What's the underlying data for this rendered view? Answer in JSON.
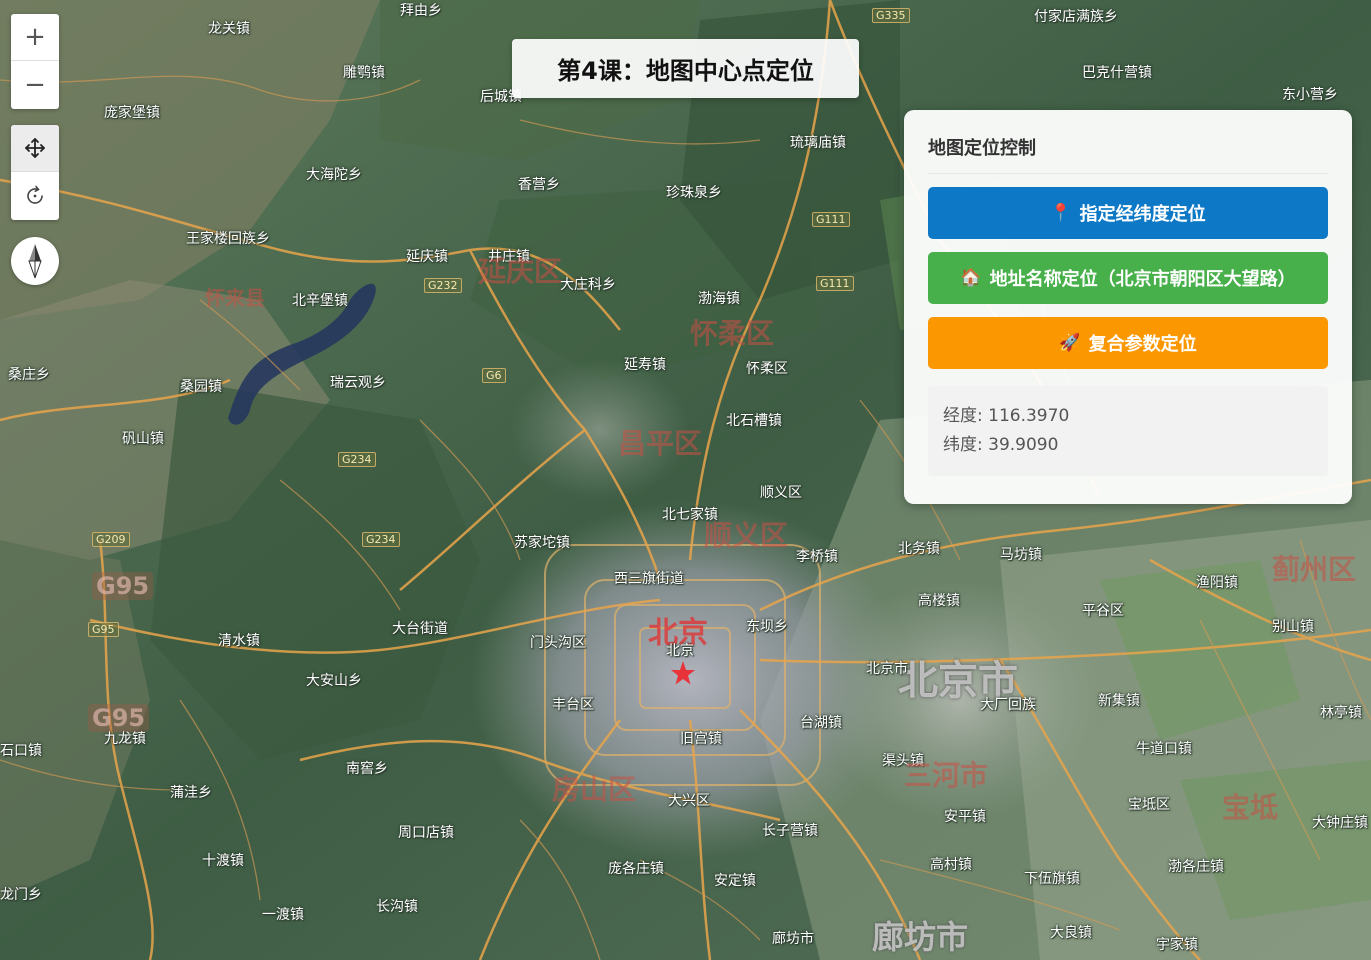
{
  "page_title": "第4课：地图中心点定位",
  "controls": {
    "zoom_in": "+",
    "zoom_out": "−",
    "pan_icon": "move-icon",
    "rotate_icon": "rotate-icon",
    "compass_icon": "compass-icon"
  },
  "panel": {
    "title": "地图定位控制",
    "buttons": [
      {
        "icon": "📍",
        "label": "指定经纬度定位",
        "color": "#0d78c6"
      },
      {
        "icon": "🏠",
        "label": "地址名称定位（北京市朝阳区大望路）",
        "color": "#47b04b"
      },
      {
        "icon": "🚀",
        "label": "复合参数定位",
        "color": "#fb9700"
      }
    ],
    "longitude_label": "经度: ",
    "longitude": "116.3970",
    "latitude_label": "纬度: ",
    "latitude": "39.9090"
  },
  "map": {
    "labels": [
      {
        "text": "龙关镇",
        "kind": "town"
      },
      {
        "text": "雕鹗镇",
        "kind": "town"
      },
      {
        "text": "后城镇",
        "kind": "town"
      },
      {
        "text": "庞家堡镇",
        "kind": "town"
      },
      {
        "text": "大海陀乡",
        "kind": "town"
      },
      {
        "text": "香营乡",
        "kind": "town"
      },
      {
        "text": "珍珠泉乡",
        "kind": "town"
      },
      {
        "text": "琉璃庙镇",
        "kind": "town"
      },
      {
        "text": "王家楼回族乡",
        "kind": "town"
      },
      {
        "text": "延庆镇",
        "kind": "town"
      },
      {
        "text": "井庄镇",
        "kind": "town"
      },
      {
        "text": "延庆区",
        "kind": "district"
      },
      {
        "text": "大庄科乡",
        "kind": "town"
      },
      {
        "text": "渤海镇",
        "kind": "town"
      },
      {
        "text": "怀柔区",
        "kind": "district"
      },
      {
        "text": "怀来县",
        "kind": "district"
      },
      {
        "text": "北辛堡镇",
        "kind": "town"
      },
      {
        "text": "延寿镇",
        "kind": "town"
      },
      {
        "text": "怀柔区",
        "kind": "town"
      },
      {
        "text": "桑园镇",
        "kind": "town"
      },
      {
        "text": "瑞云观乡",
        "kind": "town"
      },
      {
        "text": "北石槽镇",
        "kind": "town"
      },
      {
        "text": "矾山镇",
        "kind": "town"
      },
      {
        "text": "昌平区",
        "kind": "district"
      },
      {
        "text": "顺义区",
        "kind": "town"
      },
      {
        "text": "北七家镇",
        "kind": "town"
      },
      {
        "text": "顺义区",
        "kind": "district"
      },
      {
        "text": "苏家坨镇",
        "kind": "town"
      },
      {
        "text": "李桥镇",
        "kind": "town"
      },
      {
        "text": "北务镇",
        "kind": "town"
      },
      {
        "text": "马坊镇",
        "kind": "town"
      },
      {
        "text": "西三旗街道",
        "kind": "town"
      },
      {
        "text": "高楼镇",
        "kind": "town"
      },
      {
        "text": "大台街道",
        "kind": "town"
      },
      {
        "text": "北京",
        "kind": "capital"
      },
      {
        "text": "门头沟区",
        "kind": "town"
      },
      {
        "text": "东坝乡",
        "kind": "town"
      },
      {
        "text": "清水镇",
        "kind": "town"
      },
      {
        "text": "北京",
        "kind": "town"
      },
      {
        "text": "北京市",
        "kind": "city-big"
      },
      {
        "text": "北京市",
        "kind": "town"
      },
      {
        "text": "大安山乡",
        "kind": "town"
      },
      {
        "text": "丰台区",
        "kind": "town"
      },
      {
        "text": "台湖镇",
        "kind": "town"
      },
      {
        "text": "大厂回族",
        "kind": "town"
      },
      {
        "text": "新集镇",
        "kind": "town"
      },
      {
        "text": "九龙镇",
        "kind": "town"
      },
      {
        "text": "旧宫镇",
        "kind": "town"
      },
      {
        "text": "石口镇",
        "kind": "town"
      },
      {
        "text": "南窖乡",
        "kind": "town"
      },
      {
        "text": "渠头镇",
        "kind": "town"
      },
      {
        "text": "三河市",
        "kind": "district"
      },
      {
        "text": "牛道口镇",
        "kind": "town"
      },
      {
        "text": "房山区",
        "kind": "district"
      },
      {
        "text": "大兴区",
        "kind": "town"
      },
      {
        "text": "蒲洼乡",
        "kind": "town"
      },
      {
        "text": "宝坻区",
        "kind": "town"
      },
      {
        "text": "周口店镇",
        "kind": "town"
      },
      {
        "text": "长子营镇",
        "kind": "town"
      },
      {
        "text": "安平镇",
        "kind": "town"
      },
      {
        "text": "十渡镇",
        "kind": "town"
      },
      {
        "text": "庞各庄镇",
        "kind": "town"
      },
      {
        "text": "高村镇",
        "kind": "town"
      },
      {
        "text": "渤各庄镇",
        "kind": "town"
      },
      {
        "text": "安定镇",
        "kind": "town"
      },
      {
        "text": "下伍旗镇",
        "kind": "town"
      },
      {
        "text": "一渡镇",
        "kind": "town"
      },
      {
        "text": "长沟镇",
        "kind": "town"
      },
      {
        "text": "廊坊市",
        "kind": "town"
      },
      {
        "text": "廊坊市",
        "kind": "city-big"
      },
      {
        "text": "大良镇",
        "kind": "town"
      },
      {
        "text": "宇家镇",
        "kind": "town"
      },
      {
        "text": "付家店满族乡",
        "kind": "town"
      },
      {
        "text": "巴克什营镇",
        "kind": "town"
      },
      {
        "text": "东小营乡",
        "kind": "town"
      },
      {
        "text": "别山镇",
        "kind": "town"
      },
      {
        "text": "林亭镇",
        "kind": "town"
      },
      {
        "text": "大钟庄镇",
        "kind": "town"
      },
      {
        "text": "蓟州区",
        "kind": "district"
      },
      {
        "text": "渔阳镇",
        "kind": "town"
      },
      {
        "text": "平谷区",
        "kind": "town"
      },
      {
        "text": "宝坻",
        "kind": "district"
      },
      {
        "text": "桑庄乡",
        "kind": "town"
      },
      {
        "text": "龙门乡",
        "kind": "town"
      },
      {
        "text": "拜由乡",
        "kind": "town"
      },
      {
        "text": "G335",
        "kind": "road"
      },
      {
        "text": "G111",
        "kind": "road"
      },
      {
        "text": "G111",
        "kind": "road"
      },
      {
        "text": "G232",
        "kind": "road"
      },
      {
        "text": "G6",
        "kind": "road"
      },
      {
        "text": "G234",
        "kind": "road"
      },
      {
        "text": "G234",
        "kind": "road"
      },
      {
        "text": "G209",
        "kind": "road"
      },
      {
        "text": "G95",
        "kind": "road"
      },
      {
        "text": "G95",
        "kind": "road-big"
      },
      {
        "text": "G95",
        "kind": "road-big"
      }
    ]
  }
}
